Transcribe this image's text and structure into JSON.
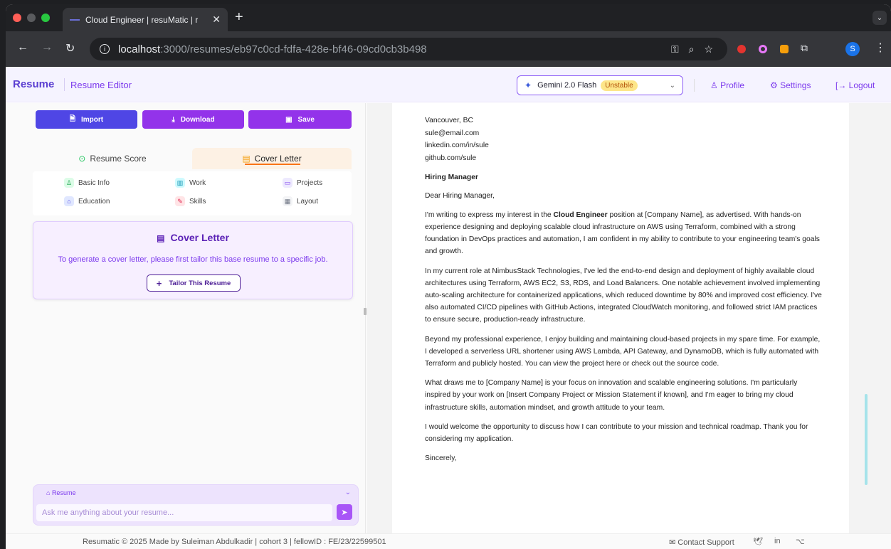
{
  "browser": {
    "tab_title": "Cloud Engineer | resuMatic | r",
    "url_host": "localhost",
    "url_path": ":3000/resumes/eb97c0cd-fdfa-428e-bf46-09cd0cb3b498",
    "profile_initial": "S"
  },
  "header": {
    "brand": "Resume",
    "subtitle": "Resume Editor",
    "model_name": "Gemini 2.0 Flash",
    "model_badge": "Unstable",
    "profile": "Profile",
    "settings": "Settings",
    "logout": "Logout"
  },
  "actions": {
    "import": "Import",
    "download": "Download",
    "save": "Save"
  },
  "tabs": {
    "score": "Resume Score",
    "cover": "Cover Letter"
  },
  "sections": [
    "Basic Info",
    "Work",
    "Projects",
    "Education",
    "Skills",
    "Layout"
  ],
  "cover_card": {
    "title": "Cover Letter",
    "description": "To generate a cover letter, please first tailor this base resume to a specific job.",
    "button": "Tailor This Resume"
  },
  "chat": {
    "label": "Resume",
    "placeholder": "Ask me anything about your resume..."
  },
  "letter": {
    "contact": [
      "Vancouver, BC",
      "sule@email.com",
      "linkedin.com/in/sule",
      "github.com/sule"
    ],
    "recipient": "Hiring Manager",
    "greeting": "Dear Hiring Manager,",
    "p1_a": "I'm writing to express my interest in the ",
    "p1_bold": "Cloud Engineer",
    "p1_b": " position at [Company Name], as advertised. With hands-on experience designing and deploying scalable cloud infrastructure on AWS using Terraform, combined with a strong foundation in DevOps practices and automation, I am confident in my ability to contribute to your engineering team's goals and growth.",
    "p2": "In my current role at NimbusStack Technologies, I've led the end-to-end design and deployment of highly available cloud architectures using Terraform, AWS EC2, S3, RDS, and Load Balancers. One notable achievement involved implementing auto-scaling architecture for containerized applications, which reduced downtime by 80% and improved cost efficiency. I've also automated CI/CD pipelines with GitHub Actions, integrated CloudWatch monitoring, and followed strict IAM practices to ensure secure, production-ready infrastructure.",
    "p3": "Beyond my professional experience, I enjoy building and maintaining cloud-based projects in my spare time. For example, I developed a serverless URL shortener using AWS Lambda, API Gateway, and DynamoDB, which is fully automated with Terraform and publicly hosted. You can view the project here or check out the source code.",
    "p4": "What draws me to [Company Name] is your focus on innovation and scalable engineering solutions. I'm particularly inspired by your work on [Insert Company Project or Mission Statement if known], and I'm eager to bring my cloud infrastructure skills, automation mindset, and growth attitude to your team.",
    "p5": "I would welcome the opportunity to discuss how I can contribute to your mission and technical roadmap. Thank you for considering my application.",
    "closing": "Sincerely,"
  },
  "footer": {
    "text": "Resumatic © 2025   Made by Suleiman Abdulkadir | cohort 3 | fellowID : FE/23/22599501",
    "support": "Contact Support"
  },
  "colors": {
    "import": "#4f46e5",
    "download": "#9333ea",
    "save": "#9333ea",
    "accent": "#7c3aed"
  }
}
